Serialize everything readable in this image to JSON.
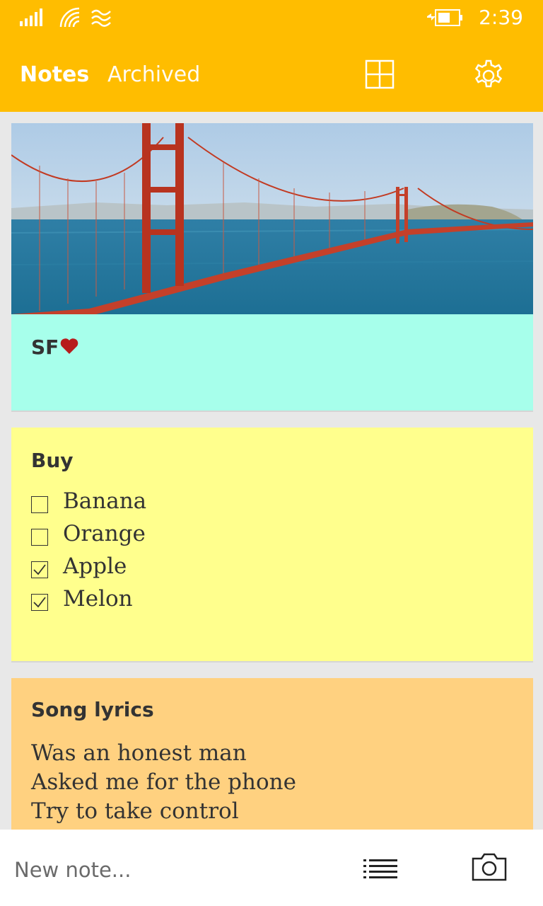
{
  "status": {
    "time": "2:39",
    "icons": [
      "signal-icon",
      "wifi-icon",
      "cellular-data-icon",
      "battery-charging-icon"
    ]
  },
  "header": {
    "tabs": [
      {
        "label": "Notes",
        "active": true
      },
      {
        "label": "Archived",
        "active": false
      }
    ],
    "actions": [
      "grid-view-icon",
      "settings-gear-icon"
    ],
    "accent_color": "#ffbd00"
  },
  "notes": [
    {
      "title": "SF",
      "title_icon": "heart-icon",
      "image": "golden-gate-bridge-photo",
      "color": "#a7ffeb"
    },
    {
      "title": "Buy",
      "color": "#ffff8d",
      "items": [
        {
          "label": "Banana",
          "checked": false
        },
        {
          "label": "Orange",
          "checked": false
        },
        {
          "label": "Apple",
          "checked": true
        },
        {
          "label": "Melon",
          "checked": true
        }
      ]
    },
    {
      "title": "Song lyrics",
      "color": "#ffd180",
      "lines": [
        "Was an honest man",
        "Asked me for the phone",
        "Try to take control"
      ]
    }
  ],
  "footer": {
    "placeholder": "New note...",
    "icons": [
      "list-icon",
      "camera-icon"
    ]
  }
}
